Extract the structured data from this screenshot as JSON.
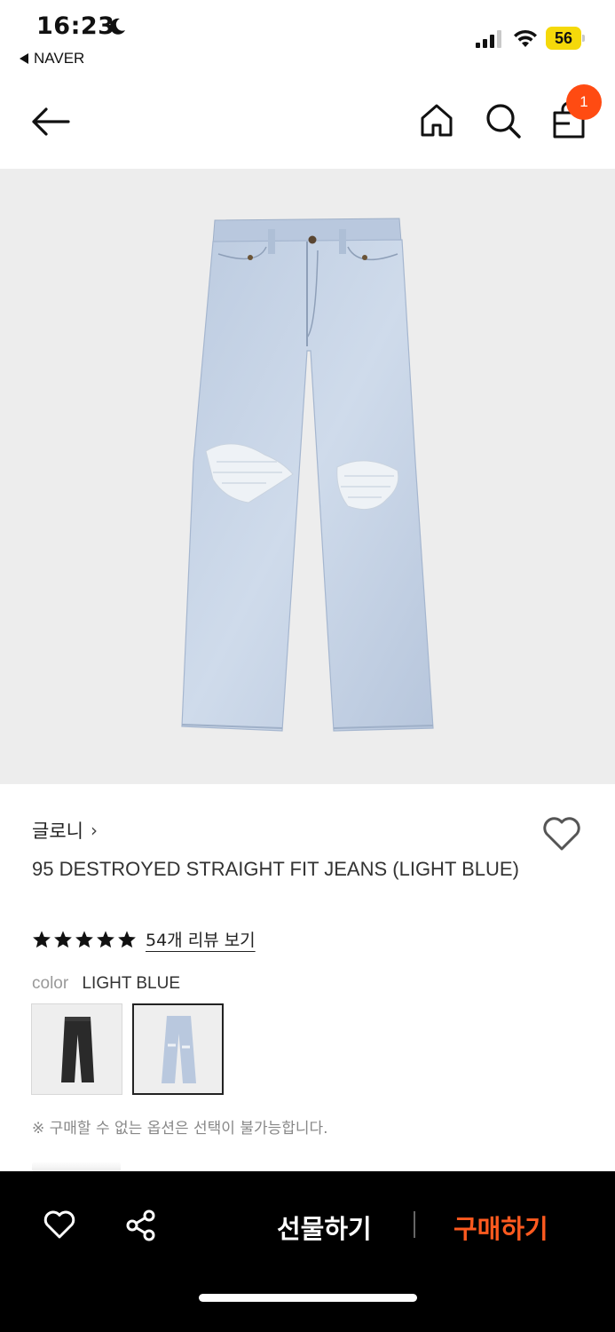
{
  "status_bar": {
    "time": "16:23",
    "back_app": "NAVER",
    "battery": "56",
    "battery_color": "#f5d90a"
  },
  "nav": {
    "cart_badge": "1",
    "badge_color": "#ff4b12"
  },
  "product": {
    "brand": "글로니",
    "brand_chevron": "›",
    "title": "95 DESTROYED STRAIGHT FIT JEANS (LIGHT BLUE)",
    "rating_stars": 5,
    "review_link": "54개 리뷰 보기",
    "color_label": "color",
    "color_value": "LIGHT BLUE",
    "options": [
      {
        "name": "BLACK",
        "selected": false
      },
      {
        "name": "LIGHT BLUE",
        "selected": true
      }
    ],
    "notice": "※ 구매할 수 없는 옵션은 선택이 불가능합니다."
  },
  "bottom_bar": {
    "gift_label": "선물하기",
    "buy_label": "구매하기",
    "buy_color": "#ff5a1f"
  },
  "icons": [
    "moon-icon",
    "signal-icon",
    "wifi-icon",
    "back-arrow-icon",
    "home-icon",
    "search-icon",
    "shopping-bag-icon",
    "heart-icon",
    "star-icon",
    "share-icon"
  ]
}
